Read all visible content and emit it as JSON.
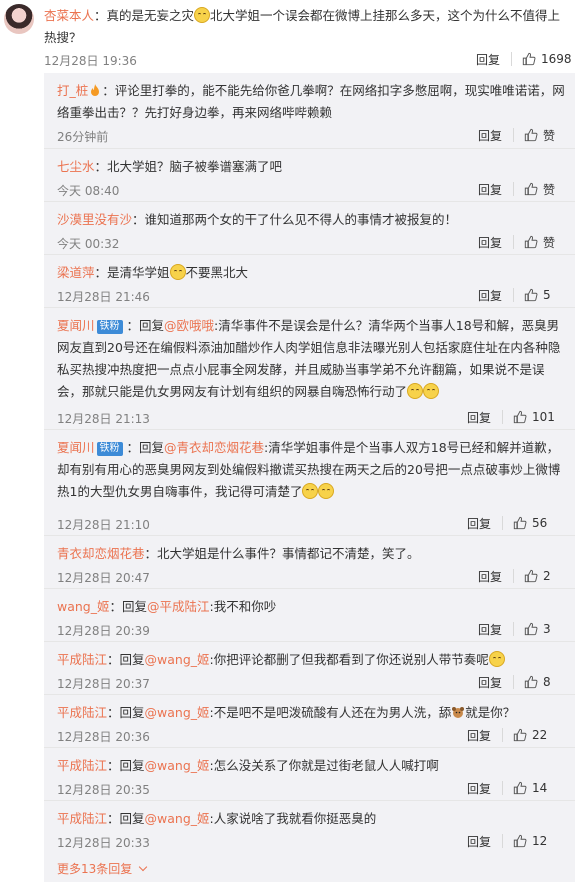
{
  "main": {
    "username": "杏菜本人",
    "text_a": "：真的是无妄之灾",
    "text_b": "北大学姐一个误会都在微博上挂那么多天，这个为什么不值得上热搜？",
    "time": "12月28日 19:36",
    "reply_label": "回复",
    "likes": "1698"
  },
  "replies": [
    {
      "user": "打_桩",
      "pre": "：评论里打拳的，能不能先给你爸几拳啊？在网络扣字多憋屈啊，现实唯唯诺诺，网络重拳出击？？先打好身边拳，再来网络哔哔赖赖",
      "time": "26分钟前",
      "reply_label": "回复",
      "likes": "赞"
    },
    {
      "user": "七尘水",
      "pre": "：北大学姐？脑子被拳谱塞满了吧",
      "time": "今天 08:40",
      "reply_label": "回复",
      "likes": "赞"
    },
    {
      "user": "沙漠里没有沙",
      "pre": "：谁知道那两个女的干了什么见不得人的事情才被报复的！",
      "time": "今天 00:32",
      "reply_label": "回复",
      "likes": "赞"
    },
    {
      "user": "梁道萍",
      "pre": "：是清华学姐",
      "post": "不要黑北大",
      "time": "12月28日 21:46",
      "reply_label": "回复",
      "likes": "5"
    },
    {
      "user": "夏闻川",
      "badge": "铁粉",
      "mid": "：回复",
      "target": "@欧哦哦",
      "pre": ":清华事件不是误会是什么？清华两个当事人18号和解，恶臭男网友直到20号还在编假料添油加醋炒作人肉学姐信息非法曝光别人包括家庭住址在内各种隐私买热搜冲热度把一点点小屁事全网发酵，并且威胁当事学弟不允许翻篇，如果说不是误会，那就只能是仇女男网友有计划有组织的网暴自嗨恐怖行动了",
      "time": "12月28日 21:13",
      "reply_label": "回复",
      "likes": "101"
    },
    {
      "user": "夏闻川",
      "badge": "铁粉",
      "mid": "：回复",
      "target": "@青衣却恋烟花巷",
      "pre": ":清华学姐事件是个当事人双方18号已经和解并道歉，却有别有用心的恶臭男网友到处编假料撤谎买热搜在两天之后的20号把一点点破事炒上微博热1的大型仇女男自嗨事件，我记得可清楚了",
      "time": "12月28日 21:10",
      "reply_label": "回复",
      "likes": "56"
    },
    {
      "user": "青衣却恋烟花巷",
      "pre": "：北大学姐是什么事件？事情都记不清楚，笑了。",
      "time": "12月28日 20:47",
      "reply_label": "回复",
      "likes": "2"
    },
    {
      "user": "wang_姬",
      "mid": "：回复",
      "target": "@平成陆江",
      "pre": ":我不和你吵",
      "time": "12月28日 20:39",
      "reply_label": "回复",
      "likes": "3"
    },
    {
      "user": "平成陆江",
      "mid": "：回复",
      "target": "@wang_姬",
      "pre": ":你把评论都删了但我都看到了你还说别人带节奏呢",
      "time": "12月28日 20:37",
      "reply_label": "回复",
      "likes": "8"
    },
    {
      "user": "平成陆江",
      "mid": "：回复",
      "target": "@wang_姬",
      "pre": ":不是吧不是吧泼硫酸有人还在为男人洗，舔",
      "post": "就是你？",
      "time": "12月28日 20:36",
      "reply_label": "回复",
      "likes": "22"
    },
    {
      "user": "平成陆江",
      "mid": "：回复",
      "target": "@wang_姬",
      "pre": ":怎么没关系了你就是过街老鼠人人喊打啊",
      "time": "12月28日 20:35",
      "reply_label": "回复",
      "likes": "14"
    },
    {
      "user": "平成陆江",
      "mid": "：回复",
      "target": "@wang_姬",
      "pre": ":人家说啥了我就看你挺恶臭的",
      "time": "12月28日 20:33",
      "reply_label": "回复",
      "likes": "12"
    }
  ],
  "more_label": "更多13条回复",
  "colors": {
    "accent": "#eb7350",
    "badge": "#3d8bd7",
    "reply_bg": "#f2f2f5"
  }
}
